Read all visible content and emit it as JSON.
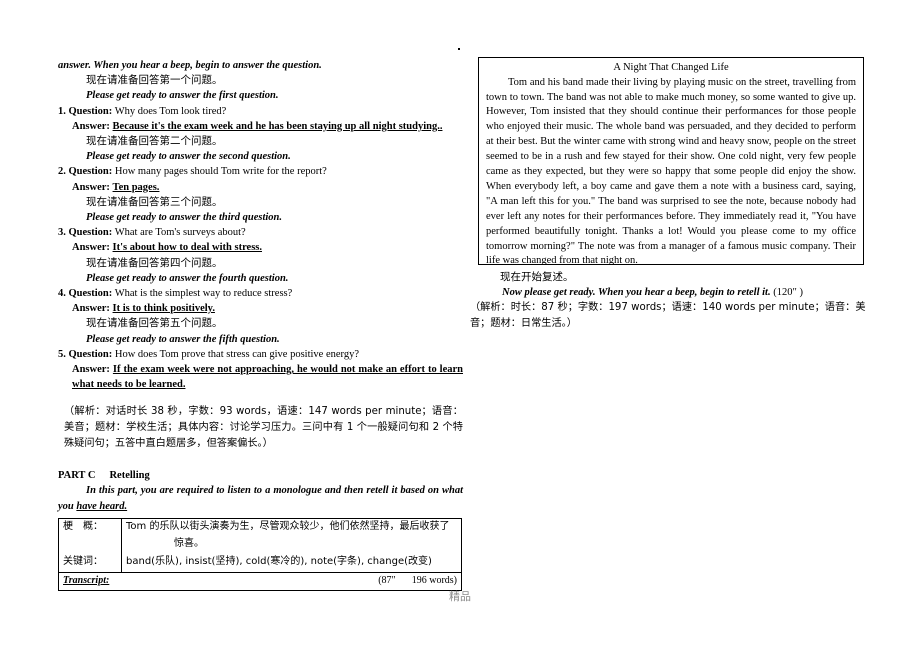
{
  "left": {
    "intro": {
      "line1": "answer. When you hear a beep, begin to answer the question.",
      "line2_cn": "现在请准备回答第一个问题。",
      "line3": "Please get ready to answer the first question."
    },
    "questions": [
      {
        "num": "1.",
        "q_label": "Question:",
        "q_text": " Why does Tom look tired?",
        "a_label": "Answer:",
        "a_text": "Because it's the exam week and he has been staying up all night studying..",
        "prompt_cn": "现在请准备回答第二个问题。",
        "prompt_en": "Please get ready to answer the second question."
      },
      {
        "num": "2.",
        "q_label": "Question:",
        "q_text": " How many pages should Tom write for the report?",
        "a_label": "Answer:",
        "a_text": "Ten pages.",
        "prompt_cn": "现在请准备回答第三个问题。",
        "prompt_en": "Please get ready to answer the third question."
      },
      {
        "num": "3.",
        "q_label": "Question:",
        "q_text": " What are Tom's surveys about?",
        "a_label": "Answer:",
        "a_text": "It's about how to deal with stress.",
        "prompt_cn": "现在请准备回答第四个问题。",
        "prompt_en": "Please get ready to answer the fourth question."
      },
      {
        "num": "4.",
        "q_label": "Question:",
        "q_text": " What is the simplest way to reduce stress?",
        "a_label": "Answer:",
        "a_text": "It is to think positively.",
        "prompt_cn": "现在请准备回答第五个问题。",
        "prompt_en": "Please get ready to answer the fifth question."
      },
      {
        "num": "5.",
        "q_label": "Question:",
        "q_text": " How does Tom prove that stress can give positive energy?",
        "a_label": "Answer:",
        "a_text": "If the exam week were not approaching, he would not make an effort to learn what needs to be learned.",
        "prompt_cn": "",
        "prompt_en": ""
      }
    ],
    "analysis": "（解析：对话时长 38 秒，字数：93 words，语速：147 words per minute；语音：美音；题材：学校生活；具体内容：讨论学习压力。三问中有 1 个一般疑问句和 2 个特殊疑问句；五答中直白题居多，但答案偏长。）",
    "part_c": {
      "label": "PART C",
      "title": "Retelling",
      "instruction": "In this part, you are required to listen to a monologue and then retell it based on what you ",
      "instruction_tail": "have heard."
    },
    "summary_table": {
      "row1_key": "梗　概：",
      "row1_val_line1": "Tom 的乐队以街头演奏为生，尽管观众较少，他们依然坚持，最后收获了",
      "row1_val_line2": "惊喜。",
      "row2_key": "关键词：",
      "row2_val": "band(乐队), insist(坚持), cold(寒冷的), note(字条), change(改变)",
      "transcript_label": "Transcript:",
      "transcript_duration": "(87″",
      "transcript_words": "196 words)"
    }
  },
  "right": {
    "passage": {
      "title": "A Night That Changed Life",
      "body": "Tom and his band made their living by playing music on the street, travelling from town to town. The band was not able to make much money, so some wanted to give up. However, Tom insisted that they should continue their performances for those people who enjoyed their music. The whole band was persuaded, and they decided to perform at their best. But the winter came with strong wind and heavy snow, people on the street seemed to be in a rush and few stayed for their show. One cold night, very few people came as they expected, but they were so happy that some people did enjoy the show. When everybody left, a boy came and gave them a note with a business card, saying, \"A man left this for you.\" The band was surprised to see the note, because nobody had ever left any notes for their performances before. They immediately read it, \"You have performed beautifully tonight. Thanks a lot! Would you please come to my office tomorrow morning?\" The note was from a manager of a famous music company. Their life was changed from that night on."
    },
    "retell_cn": "现在开始复述。",
    "retell_en": "Now please get ready. When you hear a beep, begin to retell it.",
    "retell_time": "(120″ )",
    "analysis": "（解析：时长：87 秒；字数：197 words；语速：140 words per minute；语音：美音；题材：日常生活。）"
  },
  "watermark": "精品"
}
